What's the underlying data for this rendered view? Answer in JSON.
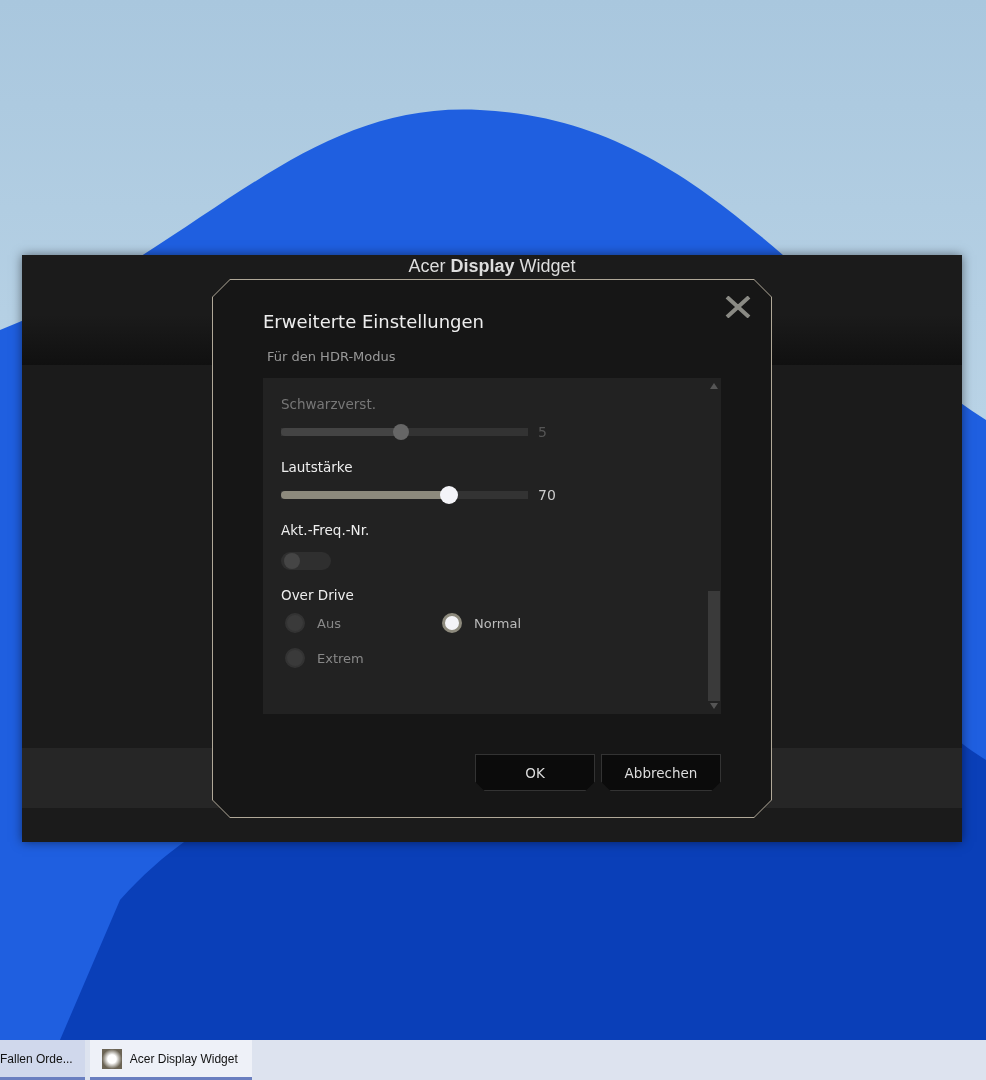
{
  "background_window": {
    "title": "Acer **Display** Widget"
  },
  "dialog": {
    "title": "Erweiterte Einstellungen",
    "subtitle": "Für den HDR-Modus",
    "settings": [
      {
        "kind": "slider",
        "label": "Schwarzverst.",
        "disabled": true,
        "level": 0.49,
        "reading": "5"
      },
      {
        "kind": "slider",
        "label": "Lautstärke",
        "disabled": false,
        "level": 0.68,
        "reading": "70"
      },
      {
        "kind": "toggle",
        "label": "Akt.-Freq.-Nr.",
        "on": false
      },
      {
        "kind": "radio",
        "label": "Over Drive",
        "options": [
          {
            "label": "Aus",
            "selected": false
          },
          {
            "label": "Normal",
            "selected": true
          },
          {
            "label": "Extrem",
            "selected": false
          }
        ]
      }
    ],
    "buttons": [
      "OK",
      "Abbrechen"
    ]
  },
  "taskbar": {
    "items": [
      {
        "label": "Fallen Orde...",
        "selected": false
      },
      {
        "label": "Acer Display Widget",
        "selected": true
      }
    ]
  }
}
